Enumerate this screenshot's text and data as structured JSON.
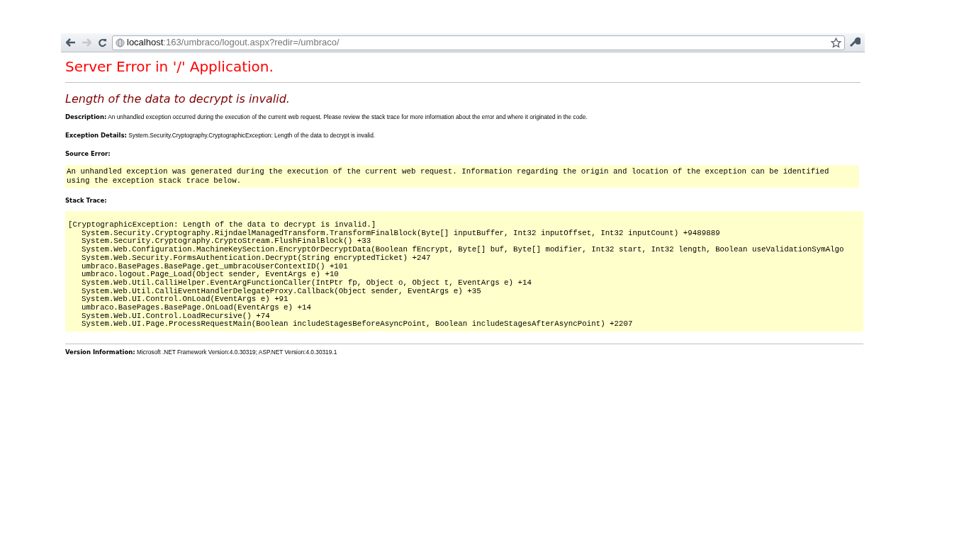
{
  "browser": {
    "back": {
      "disabled": false
    },
    "forward": {
      "disabled": true
    },
    "url_host": "localhost",
    "url_path": ":163/umbraco/logout.aspx?redir=/umbraco/",
    "bookmarked": false
  },
  "page": {
    "title": "Server Error in '/' Application.",
    "error_heading": "Length of the data to decrypt is invalid.",
    "description": {
      "label": "Description:",
      "text": "An unhandled exception occurred during the execution of the current web request. Please review the stack trace for more information about the error and where it originated in the code."
    },
    "exception_details": {
      "label": "Exception Details:",
      "text": "System.Security.Cryptography.CryptographicException: Length of the data to decrypt is invalid."
    },
    "source_error": {
      "label": "Source Error:",
      "lines": [
        "An unhandled exception was generated during the execution of the current web request. Information regarding the origin and location of the exception can be identified",
        "using the exception stack trace below."
      ]
    },
    "stack_trace": {
      "label": "Stack Trace:",
      "header": "[CryptographicException: Length of the data to decrypt is invalid.]",
      "frames": [
        "System.Security.Cryptography.RijndaelManagedTransform.TransformFinalBlock(Byte[] inputBuffer, Int32 inputOffset, Int32 inputCount) +9489889",
        "System.Security.Cryptography.CryptoStream.FlushFinalBlock() +33",
        "System.Web.Configuration.MachineKeySection.EncryptOrDecryptData(Boolean fEncrypt, Byte[] buf, Byte[] modifier, Int32 start, Int32 length, Boolean useValidationSymAlgo",
        "System.Web.Security.FormsAuthentication.Decrypt(String encryptedTicket) +247",
        "umbraco.BasePages.BasePage.get_umbracoUserContextID() +101",
        "umbraco.logout.Page_Load(Object sender, EventArgs e) +10",
        "System.Web.Util.CalliHelper.EventArgFunctionCaller(IntPtr fp, Object o, Object t, EventArgs e) +14",
        "System.Web.Util.CalliEventHandlerDelegateProxy.Callback(Object sender, EventArgs e) +35",
        "System.Web.UI.Control.OnLoad(EventArgs e) +91",
        "umbraco.BasePages.BasePage.OnLoad(EventArgs e) +14",
        "System.Web.UI.Control.LoadRecursive() +74",
        "System.Web.UI.Page.ProcessRequestMain(Boolean includeStagesBeforeAsyncPoint, Boolean includeStagesAfterAsyncPoint) +2207"
      ]
    },
    "version": {
      "label": "Version Information:",
      "text": "Microsoft .NET Framework Version:4.0.30319; ASP.NET Version:4.0.30319.1"
    }
  }
}
